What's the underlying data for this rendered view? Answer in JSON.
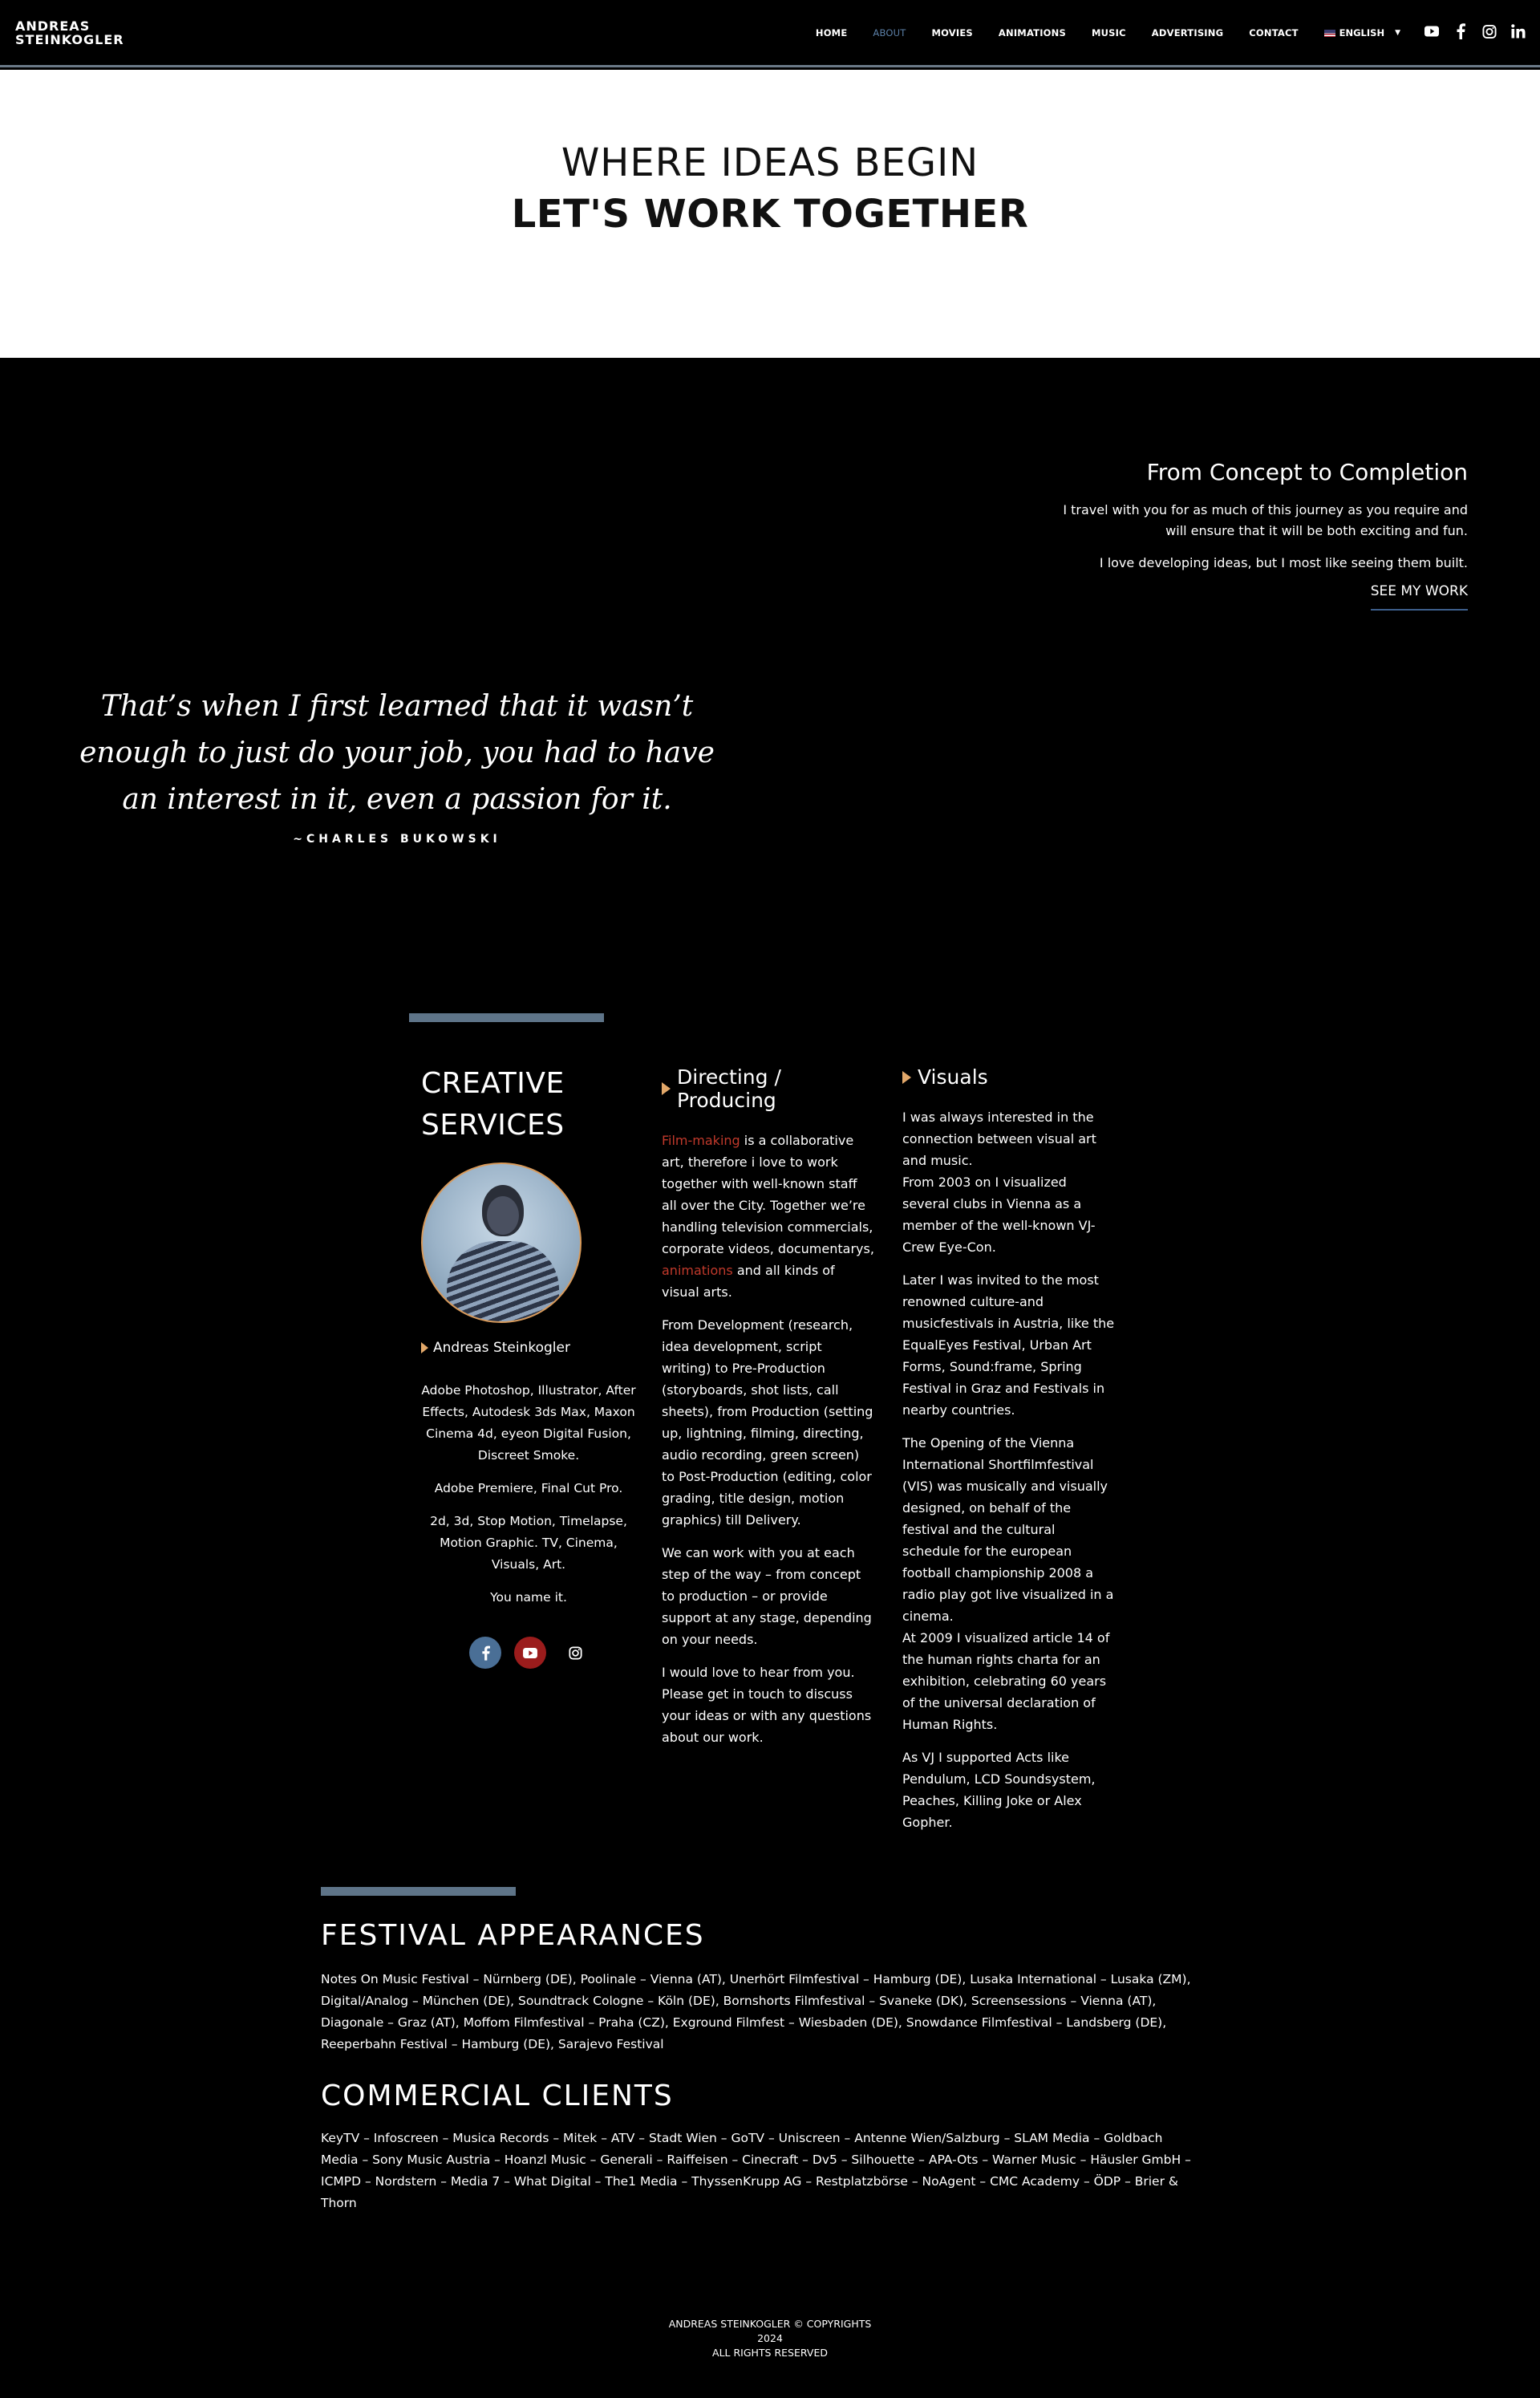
{
  "brand": {
    "line1": "ANDREAS",
    "line2": "STEINKOGLER"
  },
  "nav": {
    "items": [
      "HOME",
      "ABOUT",
      "MOVIES",
      "ANIMATIONS",
      "MUSIC",
      "ADVERTISING",
      "CONTACT"
    ],
    "active": "ABOUT",
    "language": "ENGLISH"
  },
  "social_icons": [
    "youtube-icon",
    "facebook-icon",
    "instagram-icon",
    "linkedin-icon"
  ],
  "hero": {
    "line1": "WHERE IDEAS BEGIN",
    "line2": "LET'S WORK TOGETHER"
  },
  "concept": {
    "title": "From Concept to Completion",
    "p1": "I travel with you for as much of this journey as you require and will ensure that it will be both exciting and fun.",
    "p2": "I love developing ideas, but I most like seeing them built.",
    "link": "SEE MY WORK"
  },
  "quote": {
    "text": "That’s when I first learned that it wasn’t enough to just do your job, you had to have an interest in it, even a passion for it.",
    "author": "~CHARLES BUKOWSKI"
  },
  "services": {
    "title_line1": "CREATIVE",
    "title_line2": "SERVICES",
    "name": "Andreas Steinkogler",
    "tools": [
      "Adobe Photoshop, Illustrator, After Effects, Autodesk 3ds Max, Maxon Cinema 4d, eyeon Digital Fusion, Discreet Smoke.",
      "Adobe Premiere, Final Cut Pro.",
      "2d, 3d, Stop Motion, Timelapse, Motion Graphic. TV, Cinema, Visuals, Art.",
      "You name it."
    ],
    "directing": {
      "title": "Directing / Producing",
      "p1_link1": "Film-making",
      "p1_a": " is a collaborative art, therefore i love to work together with well-known staff all over the City. Together we’re handling television commercials, corporate videos, documentarys, ",
      "p1_link2": "animations",
      "p1_b": " and all kinds of visual arts.",
      "p2": "From Development (research, idea development, script writing) to Pre-Production (storyboards, shot lists, call sheets), from Production (setting up, lightning, filming, directing, audio recording, green screen) to Post-Production (editing, color grading, title design, motion graphics) till Delivery.",
      "p3": "We can work with you at each step of the way – from concept to production – or provide support at any stage, depending on your needs.",
      "p4": "I would love to hear from you. Please get in touch to discuss your ideas or with any questions about our work."
    },
    "visuals": {
      "title": "Visuals",
      "p1": "I was always interested in the connection between visual art and music.",
      "p1b": "From 2003 on I visualized several clubs in Vienna as a member of the well-known VJ-Crew Eye-Con.",
      "p2": "Later I was invited to the most renowned culture-and musicfestivals in Austria, like the EqualEyes Festival, Urban Art Forms, Sound:frame, Spring Festival in Graz and Festivals in nearby countries.",
      "p3": "The Opening of the Vienna International Shortfilmfestival (VIS) was musically and visually designed, on behalf of the festival and the cultural schedule for the european football championship 2008 a radio play got live visualized in a cinema.",
      "p3b": "At 2009 I visualized article 14 of the human rights charta for an exhibition, celebrating 60 years of the universal declaration of Human Rights.",
      "p4": "As VJ I supported Acts like Pendulum, LCD Soundsystem, Peaches, Killing Joke or Alex Gopher."
    }
  },
  "festival": {
    "title": "FESTIVAL APPEARANCES",
    "text": "Notes On Music Festival – Nürnberg (DE), Poolinale – Vienna (AT), Unerhört Filmfestival – Hamburg (DE), Lusaka International – Lusaka (ZM), Digital/Analog – München (DE), Soundtrack Cologne – Köln (DE), Bornshorts Filmfestival – Svaneke (DK), Screensessions – Vienna (AT), Diagonale – Graz (AT), Moffom Filmfestival – Praha (CZ), Exground Filmfest – Wiesbaden (DE), Snowdance Filmfestival – Landsberg (DE), Reeperbahn Festival – Hamburg (DE), Sarajevo Festival"
  },
  "clients": {
    "title": "COMMERCIAL CLIENTS",
    "text": "KeyTV – Infoscreen – Musica Records – Mitek – ATV – Stadt Wien – GoTV – Uniscreen – Antenne Wien/Salzburg – SLAM Media – Goldbach Media – Sony Music Austria – Hoanzl Music – Generali – Raiffeisen – Cinecraft – Dv5 – Silhouette – APA-Ots – Warner Music – Häusler GmbH – ICMPD – Nordstern – Media 7 – What Digital – The1 Media – ThyssenKrupp AG – Restplatzbörse – NoAgent – CMC Academy – ÖDP – Brier & Thorn"
  },
  "footer": {
    "line1": "ANDREAS STEINKOGLER © COPYRIGHTS",
    "line2": "2024",
    "line3": "ALL RIGHTS RESERVED"
  },
  "colors": {
    "accent_blue": "#5b7fa6",
    "bar": "#5e7488",
    "triangle": "#e2a86a",
    "link_red": "#c0392b",
    "youtube_red": "#9b1c1c",
    "facebook_blue": "#4a6f96"
  }
}
